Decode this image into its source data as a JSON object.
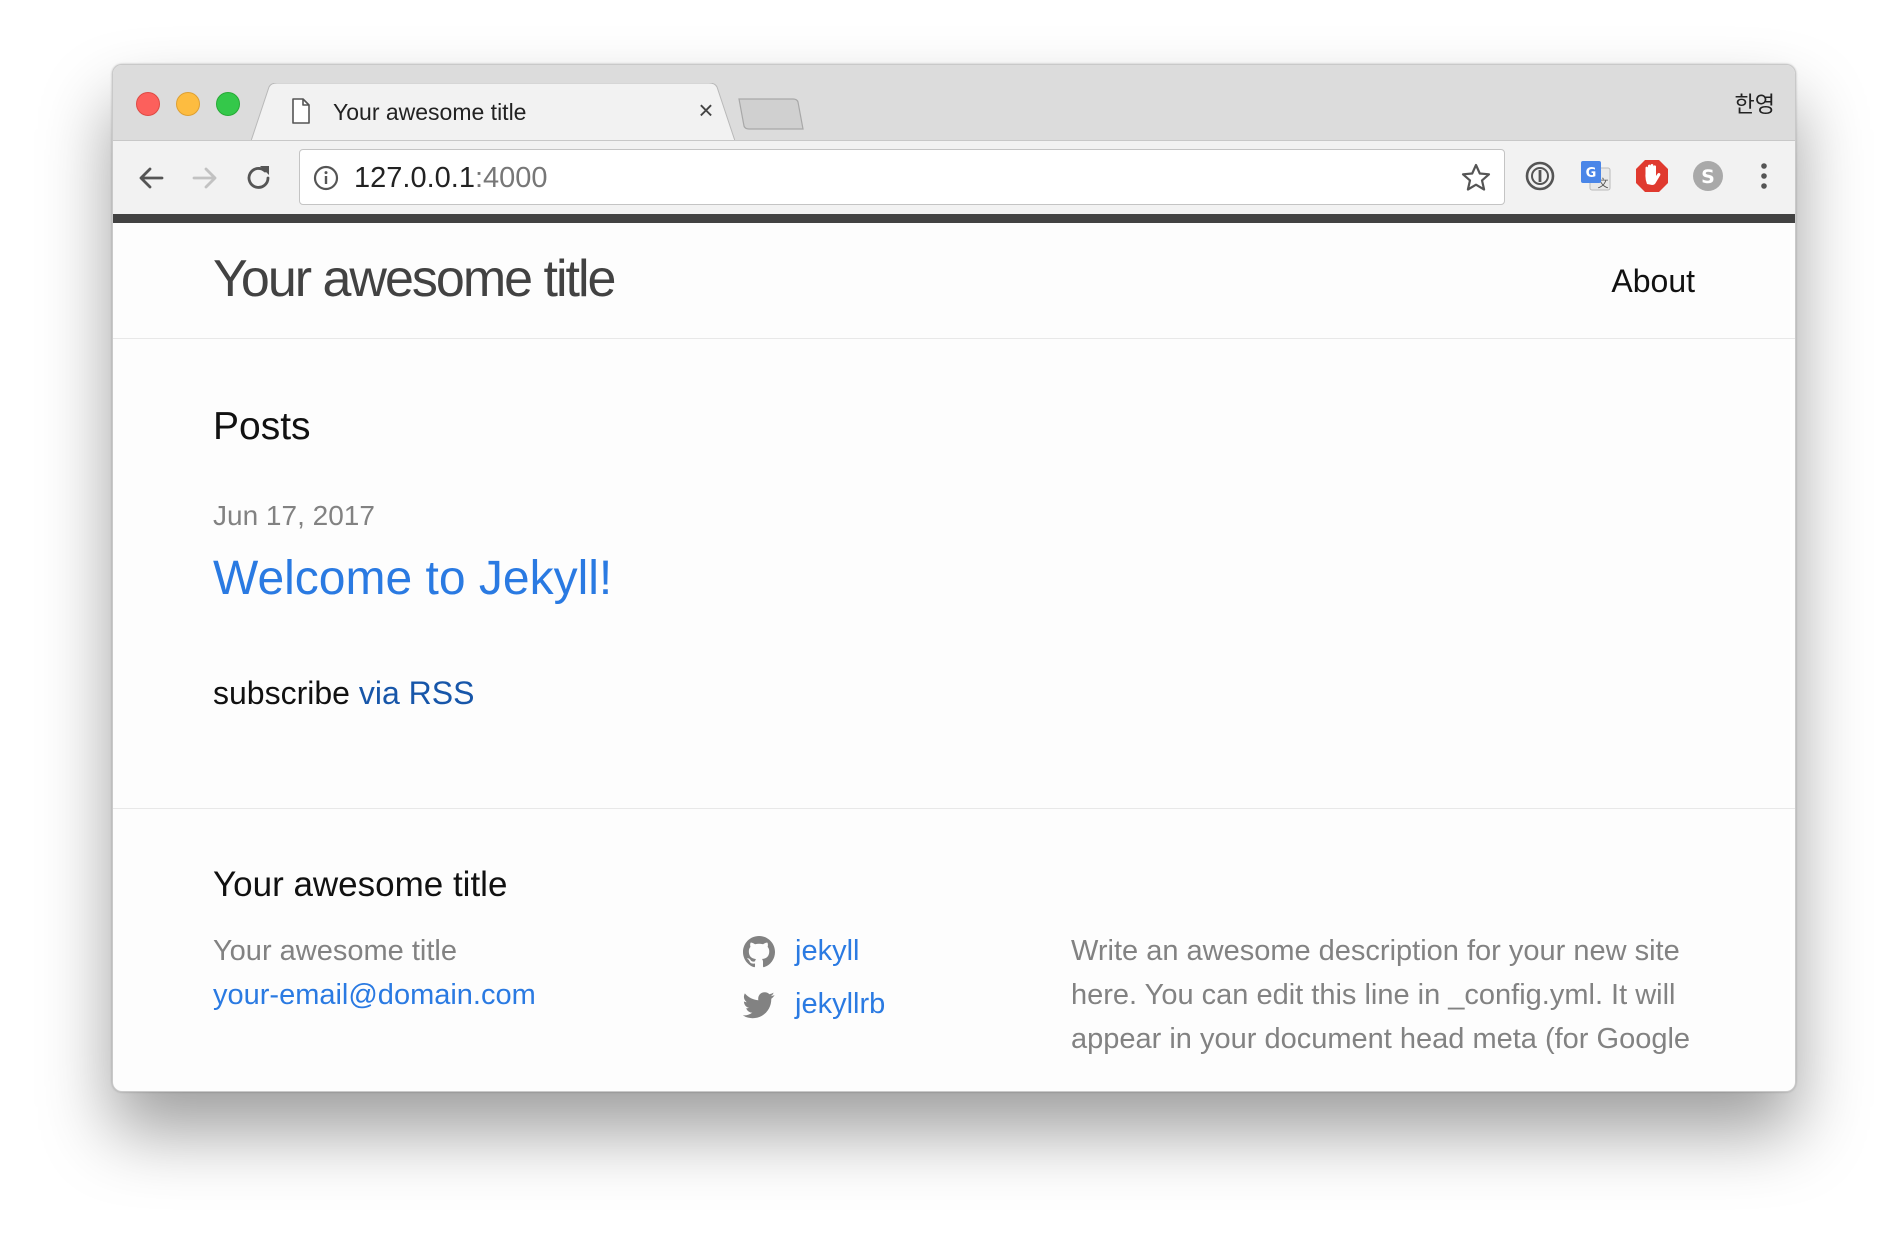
{
  "browser": {
    "tab_title": "Your awesome title",
    "tab_close_glyph": "×",
    "ime_indicator": "한영",
    "url_host": "127.0.0.1",
    "url_port": ":4000",
    "icons": {
      "back": "back-arrow-icon",
      "forward": "forward-arrow-icon",
      "reload": "reload-icon",
      "info": "info-icon",
      "bookmark": "star-icon",
      "extensions": [
        "password-manager-icon",
        "translate-icon",
        "adblock-icon",
        "s-extension-icon",
        "menu-kebab-icon"
      ]
    }
  },
  "site": {
    "title": "Your awesome title",
    "nav": {
      "about": "About"
    }
  },
  "main": {
    "heading": "Posts",
    "posts": [
      {
        "date": "Jun 17, 2017",
        "title": "Welcome to Jekyll!"
      }
    ],
    "rss_prefix": "subscribe ",
    "rss_link": "via RSS"
  },
  "footer": {
    "heading": "Your awesome title",
    "name": "Your awesome title",
    "email": "your-email@domain.com",
    "social": [
      {
        "icon": "github-icon",
        "label": "jekyll"
      },
      {
        "icon": "twitter-icon",
        "label": "jekyllrb"
      }
    ],
    "description": "Write an awesome description for your new site here. You can edit this line in _config.yml. It will appear in your document head meta (for Google"
  },
  "colors": {
    "link": "#2a7ae2",
    "rss_link": "#1756a9",
    "muted": "#828282",
    "dark_bar": "#424242"
  }
}
